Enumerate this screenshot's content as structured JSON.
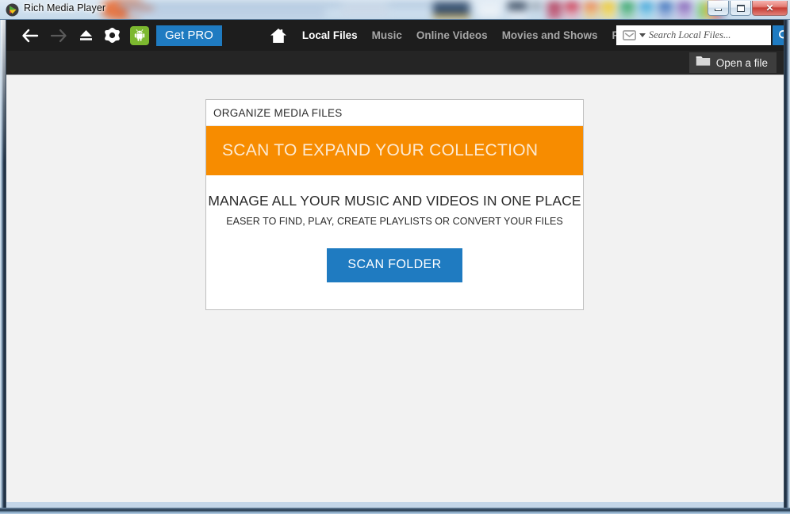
{
  "window": {
    "title": "Rich Media Player",
    "app_icon": "play-logo-icon",
    "controls": {
      "minimize_label": "–",
      "maximize_label": "□",
      "close_label": "✕"
    },
    "colors": {
      "toolbar_bg": "#1d1d1d",
      "subbar_bg": "#252525",
      "accent_blue": "#1f7bc1",
      "accent_orange": "#f78c00",
      "android_green": "#7cb82f",
      "content_bg": "#f2f2f2"
    }
  },
  "toolbar": {
    "back_icon": "arrow-left-icon",
    "forward_icon": "arrow-right-icon",
    "eject_icon": "eject-icon",
    "settings_icon": "gear-flower-icon",
    "android_icon": "android-icon",
    "get_pro_label": "Get PRO",
    "home_icon": "home-icon",
    "menu": [
      {
        "label": "Local Files",
        "active": true
      },
      {
        "label": "Music",
        "active": false
      },
      {
        "label": "Online Videos",
        "active": false
      },
      {
        "label": "Movies and Shows",
        "active": false
      },
      {
        "label": "Playlists",
        "active": false
      }
    ]
  },
  "search": {
    "scope_icon": "inbox-icon",
    "caret_icon": "chevron-down-icon",
    "placeholder": "Search Local Files...",
    "value": "",
    "submit_icon": "search-icon"
  },
  "subbar": {
    "open_file_label": "Open a file",
    "open_file_icon": "folder-icon"
  },
  "card": {
    "title": "ORGANIZE MEDIA FILES",
    "banner": "SCAN TO EXPAND YOUR COLLECTION",
    "headline": "MANAGE ALL YOUR MUSIC AND VIDEOS IN ONE PLACE",
    "subline": "EASER TO FIND, PLAY, CREATE PLAYLISTS OR CONVERT YOUR FILES",
    "scan_button_label": "SCAN FOLDER"
  }
}
